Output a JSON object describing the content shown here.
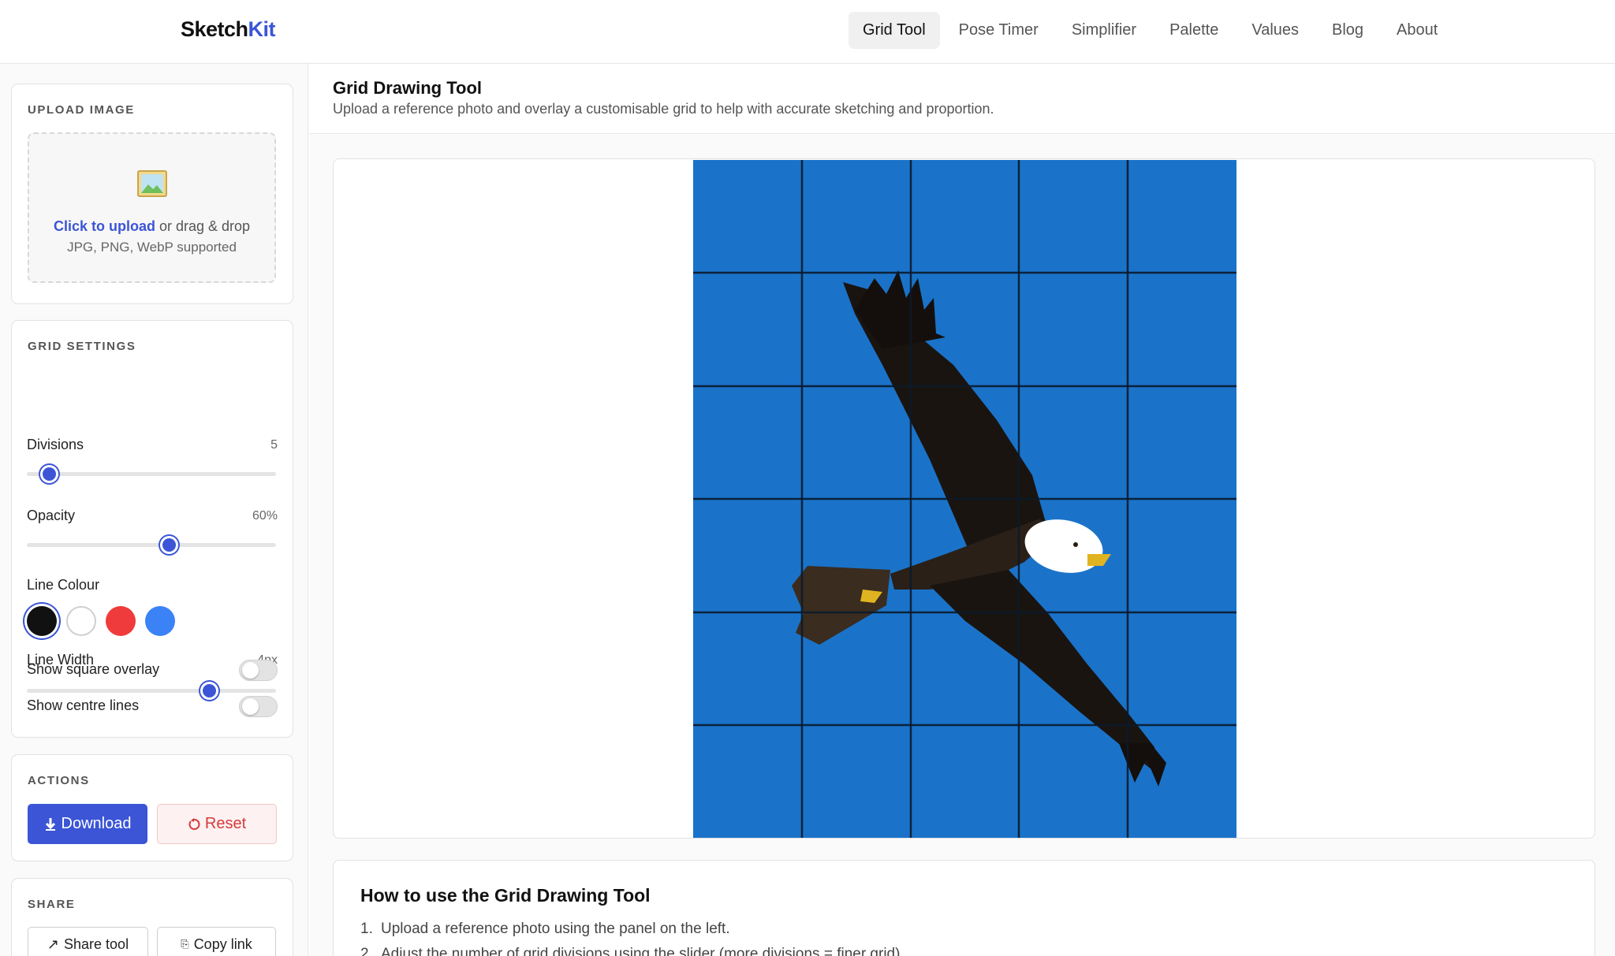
{
  "logo": {
    "part1": "Sketch",
    "part2": "Kit"
  },
  "nav": [
    {
      "label": "Grid Tool",
      "active": true
    },
    {
      "label": "Pose Timer",
      "active": false
    },
    {
      "label": "Simplifier",
      "active": false
    },
    {
      "label": "Palette",
      "active": false
    },
    {
      "label": "Values",
      "active": false
    },
    {
      "label": "Blog",
      "active": false
    },
    {
      "label": "About",
      "active": false
    }
  ],
  "upload": {
    "title": "UPLOAD IMAGE",
    "link_text": "Click to upload",
    "rest_text": " or drag & drop",
    "formats": "JPG, PNG, WebP supported"
  },
  "grid_settings": {
    "title": "GRID SETTINGS",
    "divisions": {
      "label": "Divisions",
      "value": "5",
      "level": 0.09
    },
    "opacity": {
      "label": "Opacity",
      "value": "60%",
      "level": 0.57
    },
    "line_colour": {
      "label": "Line Colour",
      "options": [
        "#111111",
        "#ffffff",
        "#ef3b3b",
        "#3b82f6"
      ],
      "selected": 0
    },
    "line_width": {
      "label": "Line Width",
      "value": "4px",
      "level": 0.73
    },
    "square_overlay": {
      "label": "Show square overlay",
      "on": false
    },
    "centre_lines": {
      "label": "Show centre lines",
      "on": false
    }
  },
  "actions": {
    "title": "ACTIONS",
    "download": "Download",
    "reset": "Reset"
  },
  "share": {
    "title": "SHARE",
    "share_tool": "Share tool",
    "copy_link": "Copy link"
  },
  "main": {
    "title": "Grid Drawing Tool",
    "subtitle": "Upload a reference photo and overlay a customisable grid to help with accurate sketching and proportion."
  },
  "howto": {
    "title": "How to use the Grid Drawing Tool",
    "steps": [
      "Upload a reference photo using the panel on the left.",
      "Adjust the number of grid divisions using the slider (more divisions = finer grid)."
    ]
  },
  "colors": {
    "accent": "#3b55d6",
    "sky": "#1a73c9",
    "danger": "#d63b3b"
  }
}
